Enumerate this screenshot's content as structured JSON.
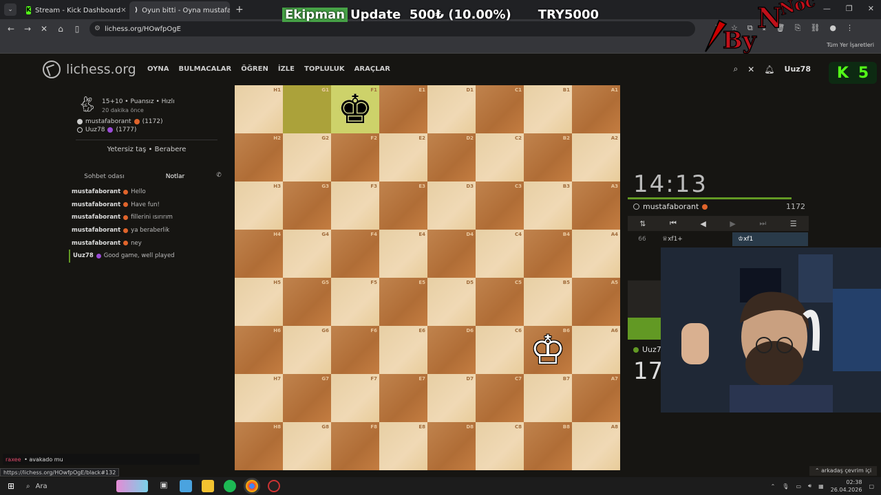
{
  "browser": {
    "tabs": [
      {
        "title": "Stream - Kick Dashboard",
        "fav_color": "#53fc18",
        "fav_glyph": "K"
      },
      {
        "title": "Oyun bitti - Oyna mustafaborant",
        "fav_color": "#ffffff",
        "fav_glyph": "♞"
      }
    ],
    "url": "lichess.org/HOwfpOgE",
    "bookmarks_all": "Tüm Yer İşaretleri",
    "status_url": "https://lichess.org/HOwfpOgE/black#132"
  },
  "overlay": {
    "ticker_brand": "Ekipman",
    "ticker_rest": "Update  500₺ (10.00%)",
    "ticker_target": "TRY5000",
    "kick_badge_k": "K",
    "kick_badge_n": "5"
  },
  "lichess": {
    "logo": "lichess.org",
    "nav": [
      "OYNA",
      "BULMACALAR",
      "ÖĞREN",
      "İZLE",
      "TOPLULUK",
      "ARAÇLAR"
    ],
    "username": "Uuz78"
  },
  "game": {
    "mode": "15+10 • Puansız • Hızlı",
    "when": "20 dakika önce",
    "white_player": "mustafaborant",
    "white_rating": "(1172)",
    "black_player": "Uuz78",
    "black_rating": "(1777)",
    "result": "Yetersiz taş • Berabere"
  },
  "chat": {
    "tab_chat": "Sohbet odası",
    "tab_notes": "Notlar",
    "messages": [
      {
        "user": "mustafaborant",
        "text": "Hello"
      },
      {
        "user": "mustafaborant",
        "text": "Have fun!"
      },
      {
        "user": "mustafaborant",
        "text": "fillerini ısırırım"
      },
      {
        "user": "mustafaborant",
        "text": "ya beraberlik"
      },
      {
        "user": "mustafaborant",
        "text": "ney"
      },
      {
        "user": "Uuz78",
        "text": "Good game, well played"
      }
    ]
  },
  "kick_chat": {
    "user": "raxee",
    "text": "avakado mu"
  },
  "board": {
    "files": [
      "H",
      "G",
      "F",
      "E",
      "D",
      "C",
      "B",
      "A"
    ],
    "ranks": [
      "1",
      "2",
      "3",
      "4",
      "5",
      "6",
      "7",
      "8"
    ],
    "pieces": [
      {
        "square": "F1",
        "glyph": "♚",
        "color": "black"
      },
      {
        "square": "B6",
        "glyph": "♔",
        "color": "white"
      }
    ],
    "highlight": [
      "G1",
      "F1"
    ]
  },
  "side": {
    "top_clock": "14:13",
    "top_player": "mustafaborant",
    "top_rating": "1172",
    "controls": [
      "⇅",
      "⏮",
      "◀",
      "▶",
      "⏭",
      "☰"
    ],
    "move_num": "66",
    "move_white": "♕xf1+",
    "move_black": "♔xf1",
    "bottom_player": "Uuz7",
    "bottom_clock": "17"
  },
  "friends": "⌃ arkadaş çevrim içi",
  "taskbar": {
    "search": "Ara",
    "time": "02:38",
    "date": "26.04.2026"
  }
}
